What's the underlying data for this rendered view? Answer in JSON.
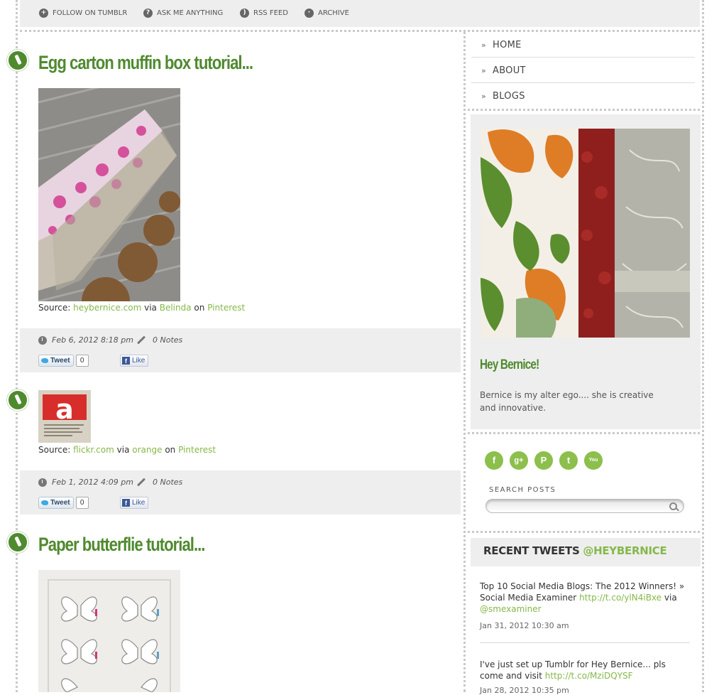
{
  "topnav": [
    {
      "label": "FOLLOW ON TUMBLR",
      "icon": "plus-icon"
    },
    {
      "label": "ASK ME ANYTHING",
      "icon": "question-icon"
    },
    {
      "label": "RSS FEED",
      "icon": "rss-icon"
    },
    {
      "label": "ARCHIVE",
      "icon": "archive-icon"
    }
  ],
  "posts": [
    {
      "title": "Egg carton muffin box tutorial...",
      "source_label": "Source:",
      "source_link": "heybernice.com",
      "via_label": "via",
      "via_link": "Belinda",
      "on_label": "on",
      "on_link": "Pinterest",
      "date": "Feb 6, 2012 8:18 pm",
      "notes": "0 Notes",
      "tweet_label": "Tweet",
      "tweet_count": "0",
      "like_label": "Like"
    },
    {
      "title": "",
      "source_label": "Source:",
      "source_link": "flickr.com",
      "via_label": "via",
      "via_link": "orange",
      "on_label": "on",
      "on_link": "Pinterest",
      "date": "Feb 1, 2012 4:09 pm",
      "notes": "0 Notes",
      "tweet_label": "Tweet",
      "tweet_count": "0",
      "like_label": "Like"
    },
    {
      "title": "Paper butterflie tutorial..."
    }
  ],
  "sidebar": {
    "nav": [
      "HOME",
      "ABOUT",
      "BLOGS"
    ],
    "profile_title": "Hey Bernice!",
    "profile_text": "Bernice is my alter ego.... she is creative and innovative.",
    "social": [
      {
        "icon": "facebook-icon",
        "glyph": "f"
      },
      {
        "icon": "google-plus-icon",
        "glyph": "g+"
      },
      {
        "icon": "pinterest-icon",
        "glyph": "P"
      },
      {
        "icon": "twitter-icon",
        "glyph": "t"
      },
      {
        "icon": "youtube-icon",
        "glyph": "You"
      }
    ],
    "search_label": "SEARCH POSTS",
    "search_value": "",
    "recent_tweets_label": "RECENT TWEETS",
    "recent_tweets_handle": "@HEYBERNICE",
    "tweets": [
      {
        "text_before": "Top 10 Social Media Blogs: The 2012 Winners! » Social Media Examiner",
        "link": "http://t.co/ylN4iBxe",
        "via_label": "via",
        "mention": "@smexaminer",
        "time": "Jan 31, 2012 10:30 am"
      },
      {
        "text_before": "I've just set up Tumblr for Hey Bernice... pls come and visit",
        "link": "http://t.co/MziDQYSF",
        "time": "Jan 28, 2012 10:35 pm"
      }
    ]
  },
  "colors": {
    "accent_green": "#4f8a2f",
    "link_green": "#86b84a",
    "panel_gray": "#eeeeee"
  }
}
